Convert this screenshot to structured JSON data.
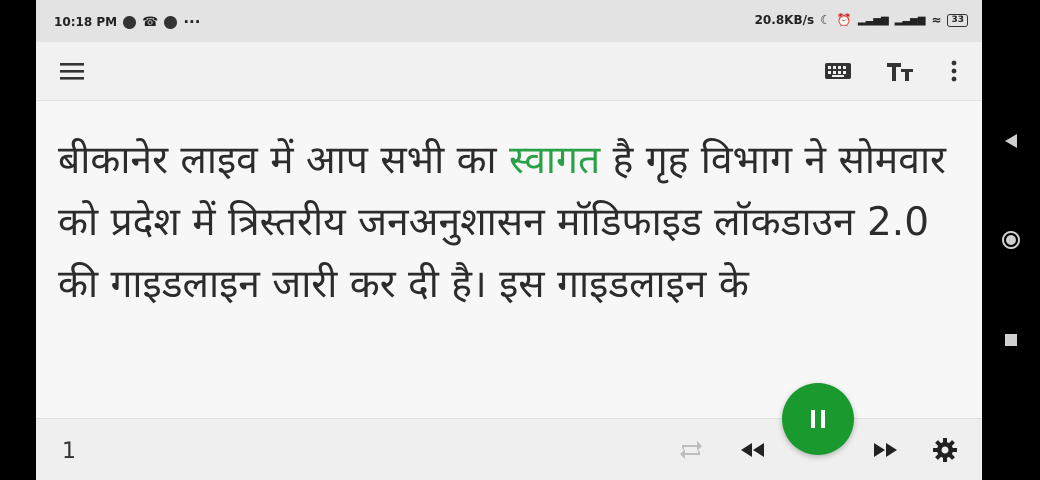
{
  "status_bar": {
    "time": "10:18 PM",
    "extra": "···",
    "network_speed": "20.8KB/s",
    "battery": "33"
  },
  "toolbar": {
    "menu_icon": "menu-icon",
    "keyboard_icon": "keyboard-icon",
    "text_size_icon": "text-size-icon",
    "more_icon": "more-vert-icon"
  },
  "reader": {
    "pre": " बीकानेर लाइव में आप सभी का ",
    "highlight": "स्वागत",
    "post": " है गृह विभाग ने सोमवार को प्रदेश में त्रिस्तरीय जनअनुशासन मॉडिफाइड लॉकडाउन 2.0 की गाइडलाइन जारी कर दी है। इस गाइडलाइन के",
    "highlight_color": "#2aa146"
  },
  "bottom_bar": {
    "page_number": "1",
    "repeat_icon": "repeat-icon",
    "rewind_icon": "rewind-icon",
    "pause_icon": "pause-icon",
    "forward_icon": "fast-forward-icon",
    "settings_icon": "settings-gear-icon",
    "accent_color": "#1a9a2e"
  },
  "nav_bar": {
    "back_icon": "back-triangle-icon",
    "home_icon": "home-circle-icon",
    "recents_icon": "recents-square-icon"
  }
}
